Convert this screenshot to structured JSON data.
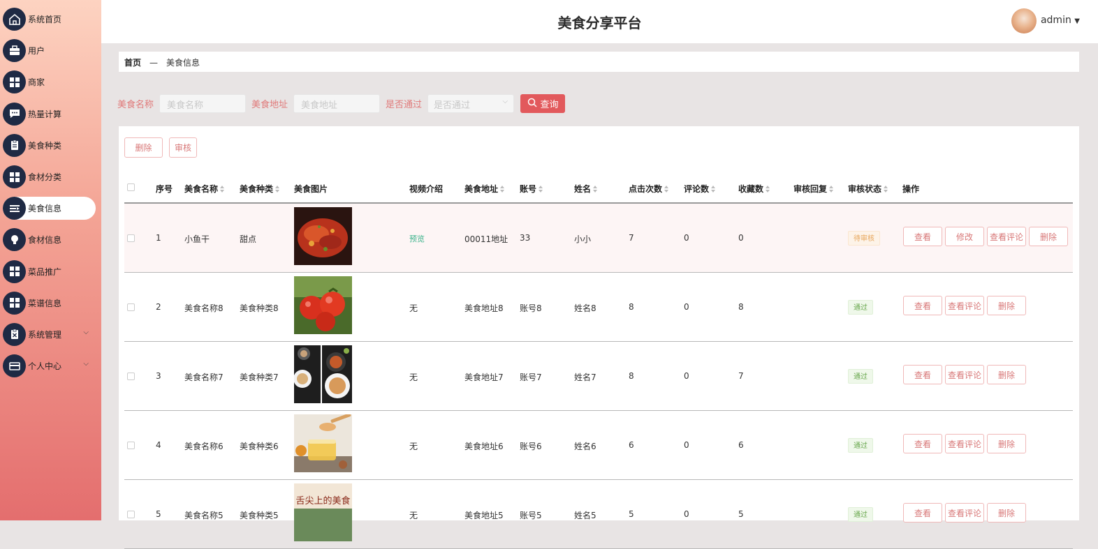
{
  "app": {
    "title": "美食分享平台",
    "user": "admin",
    "user_caret": "▼"
  },
  "sidebar": {
    "items": [
      {
        "label": "系统首页",
        "icon": "home-icon"
      },
      {
        "label": "用户",
        "icon": "briefcase-icon"
      },
      {
        "label": "商家",
        "icon": "grid-icon"
      },
      {
        "label": "热量计算",
        "icon": "chat-icon"
      },
      {
        "label": "美食种类",
        "icon": "clipboard-icon"
      },
      {
        "label": "食材分类",
        "icon": "grid-icon"
      },
      {
        "label": "美食信息",
        "icon": "list-icon",
        "active": true
      },
      {
        "label": "食材信息",
        "icon": "bulb-icon"
      },
      {
        "label": "菜品推广",
        "icon": "grid-icon"
      },
      {
        "label": "菜谱信息",
        "icon": "grid-icon"
      },
      {
        "label": "系统管理",
        "icon": "clipboard-x-icon",
        "expandable": true
      },
      {
        "label": "个人中心",
        "icon": "card-icon",
        "expandable": true
      }
    ]
  },
  "breadcrumb": {
    "home": "首页",
    "separator": "—",
    "current": "美食信息"
  },
  "search": {
    "name_label": "美食名称",
    "name_placeholder": "美食名称",
    "addr_label": "美食地址",
    "addr_placeholder": "美食地址",
    "pass_label": "是否通过",
    "pass_placeholder": "是否通过",
    "query_label": "查询"
  },
  "toolbar": {
    "delete_label": "删除",
    "audit_label": "审核"
  },
  "table": {
    "headers": {
      "index": "序号",
      "name": "美食名称",
      "type": "美食种类",
      "image": "美食图片",
      "video": "视频介绍",
      "address": "美食地址",
      "account": "账号",
      "username": "姓名",
      "clicks": "点击次数",
      "comments": "评论数",
      "favorites": "收藏数",
      "reply": "审核回复",
      "status": "审核状态",
      "actions": "操作"
    },
    "action_labels": {
      "view": "查看",
      "edit": "修改",
      "view_comments": "查看评论",
      "delete": "删除"
    },
    "rows": [
      {
        "index": "1",
        "name": "小鱼干",
        "type": "甜点",
        "video": "预览",
        "address": "00011地址",
        "account": "33",
        "username": "小小",
        "clicks": "7",
        "comments": "0",
        "favorites": "0",
        "status": "待审核"
      },
      {
        "index": "2",
        "name": "美食名称8",
        "type": "美食种类8",
        "video": "无",
        "address": "美食地址8",
        "account": "账号8",
        "username": "姓名8",
        "clicks": "8",
        "comments": "0",
        "favorites": "8",
        "status": "通过"
      },
      {
        "index": "3",
        "name": "美食名称7",
        "type": "美食种类7",
        "video": "无",
        "address": "美食地址7",
        "account": "账号7",
        "username": "姓名7",
        "clicks": "8",
        "comments": "0",
        "favorites": "7",
        "status": "通过"
      },
      {
        "index": "4",
        "name": "美食名称6",
        "type": "美食种类6",
        "video": "无",
        "address": "美食地址6",
        "account": "账号6",
        "username": "姓名6",
        "clicks": "6",
        "comments": "0",
        "favorites": "6",
        "status": "通过"
      },
      {
        "index": "5",
        "name": "美食名称5",
        "type": "美食种类5",
        "video": "无",
        "address": "美食地址5",
        "account": "账号5",
        "username": "姓名5",
        "clicks": "5",
        "comments": "0",
        "favorites": "5",
        "status": "通过"
      }
    ]
  },
  "image_captions": {
    "row5": "舌尖上的美食"
  }
}
